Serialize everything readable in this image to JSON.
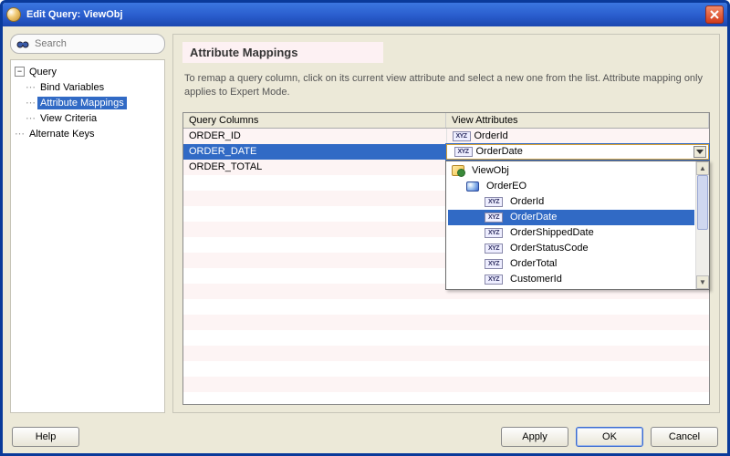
{
  "window": {
    "title": "Edit Query: ViewObj"
  },
  "search": {
    "placeholder": "Search"
  },
  "tree": {
    "query": "Query",
    "bind_vars": "Bind Variables",
    "attr_map": "Attribute Mappings",
    "view_crit": "View Criteria",
    "alt_keys": "Alternate Keys"
  },
  "main": {
    "heading": "Attribute Mappings",
    "hint": "To remap a query column, click on its current view attribute and select a new one from the list.  Attribute mapping only applies to Expert Mode.",
    "col_query": "Query Columns",
    "col_view": "View Attributes",
    "rows": [
      {
        "q": "ORDER_ID",
        "v": "OrderId"
      },
      {
        "q": "ORDER_DATE",
        "v": "OrderDate"
      },
      {
        "q": "ORDER_TOTAL",
        "v": ""
      }
    ],
    "dropdown": {
      "root": "ViewObj",
      "entity": "OrderEO",
      "attrs": [
        "OrderId",
        "OrderDate",
        "OrderShippedDate",
        "OrderStatusCode",
        "OrderTotal",
        "CustomerId"
      ],
      "selected": "OrderDate"
    }
  },
  "buttons": {
    "help": "Help",
    "apply": "Apply",
    "ok": "OK",
    "cancel": "Cancel"
  }
}
